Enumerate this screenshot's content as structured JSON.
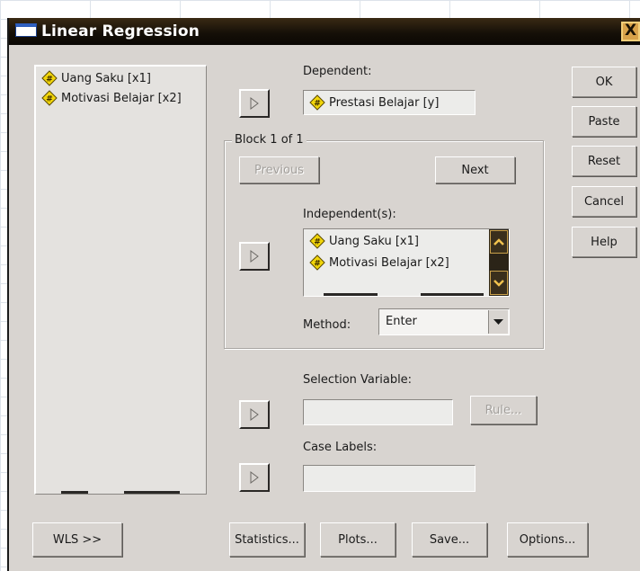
{
  "window": {
    "title": "Linear Regression",
    "close_glyph": "X"
  },
  "source_list": {
    "items": [
      {
        "label": "Uang Saku [x1]",
        "icon": "scale-variable-icon"
      },
      {
        "label": "Motivasi Belajar [x2]",
        "icon": "scale-variable-icon"
      }
    ]
  },
  "dependent": {
    "label": "Dependent:",
    "value": "Prestasi Belajar [y]",
    "icon": "scale-variable-icon"
  },
  "block": {
    "legend": "Block 1 of 1",
    "previous_label": "Previous",
    "next_label": "Next",
    "independents_label": "Independent(s):",
    "independents": [
      {
        "label": "Uang Saku [x1]",
        "icon": "scale-variable-icon"
      },
      {
        "label": "Motivasi Belajar [x2]",
        "icon": "scale-variable-icon"
      }
    ],
    "method_label": "Method:",
    "method_value": "Enter"
  },
  "selection": {
    "label": "Selection Variable:",
    "rule_label": "Rule..."
  },
  "case_labels": {
    "label": "Case Labels:"
  },
  "side_buttons": {
    "ok": "OK",
    "paste": "Paste",
    "reset": "Reset",
    "cancel": "Cancel",
    "help": "Help"
  },
  "bottom_buttons": {
    "wls": "WLS >>",
    "statistics": "Statistics...",
    "plots": "Plots...",
    "save": "Save...",
    "options": "Options..."
  },
  "colors": {
    "titlebar": "#161008",
    "dialog_bg": "#d8d4d0",
    "scrollbar_accent": "#b88f2c",
    "variable_icon": "#f2d60a"
  }
}
